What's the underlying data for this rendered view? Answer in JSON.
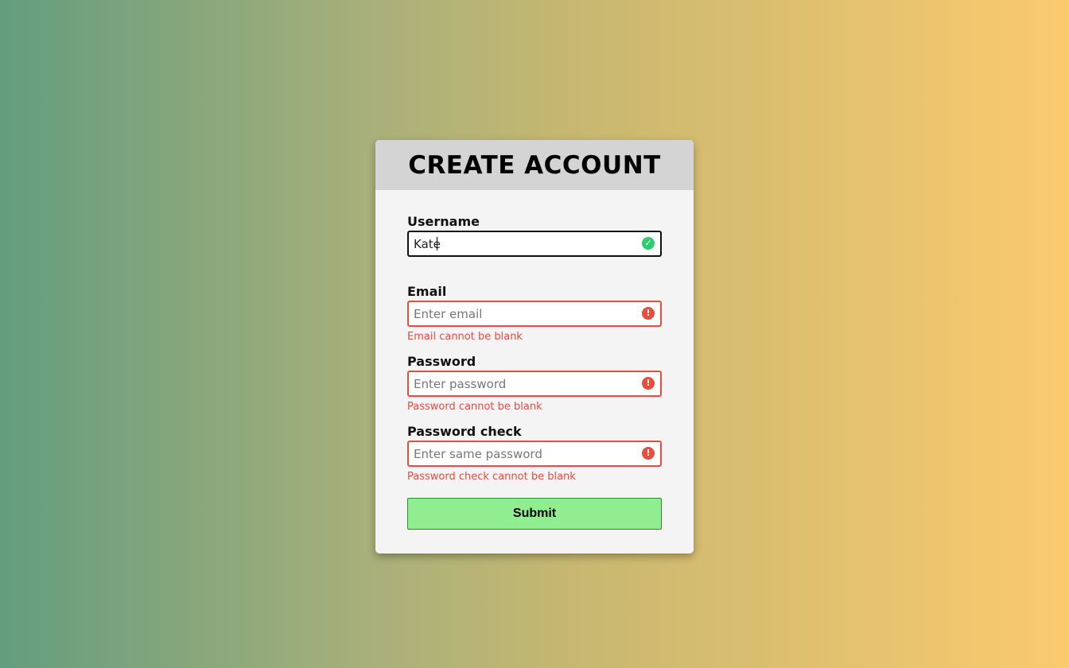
{
  "title": "CREATE ACCOUNT",
  "fields": {
    "username": {
      "label": "Username",
      "value": "Kate",
      "placeholder": "",
      "status": "success",
      "error": ""
    },
    "email": {
      "label": "Email",
      "value": "",
      "placeholder": "Enter email",
      "status": "error",
      "error": "Email cannot be blank"
    },
    "password": {
      "label": "Password",
      "value": "",
      "placeholder": "Enter password",
      "status": "error",
      "error": "Password cannot be blank"
    },
    "password_check": {
      "label": "Password check",
      "value": "",
      "placeholder": "Enter same password",
      "status": "error",
      "error": "Password check cannot be blank"
    }
  },
  "submit_label": "Submit",
  "icons": {
    "success": "check-circle-icon",
    "error": "exclamation-circle-icon"
  },
  "colors": {
    "success": "#2ecc71",
    "error": "#e74c3c",
    "submit_bg": "#90ee90"
  }
}
